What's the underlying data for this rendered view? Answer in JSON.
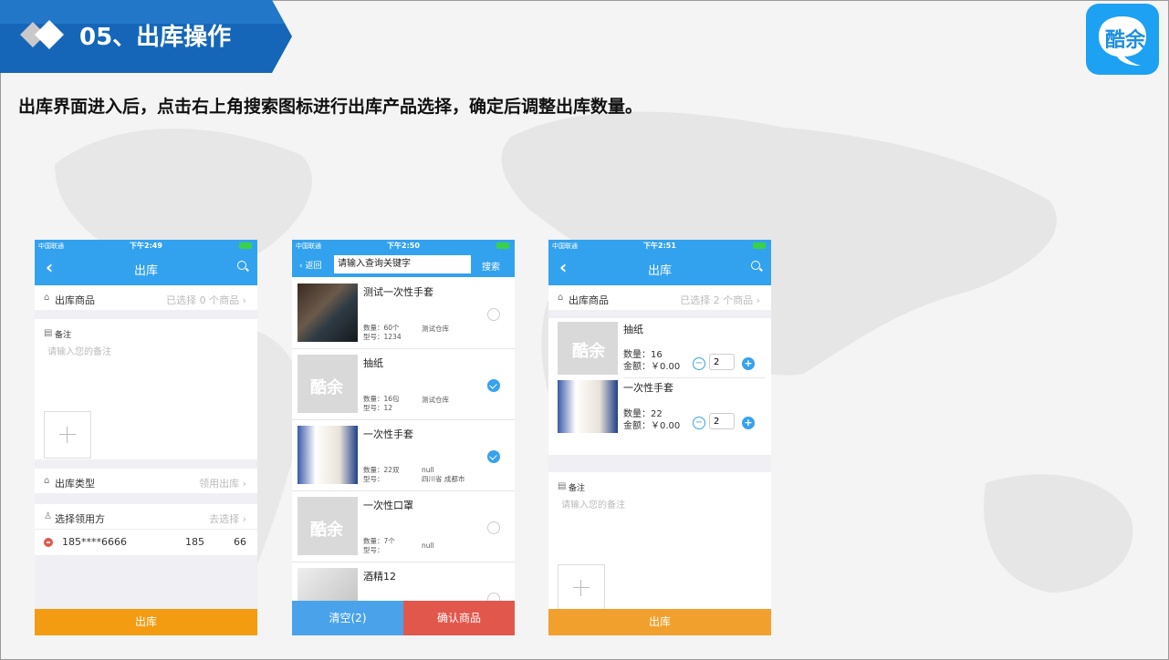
{
  "header": {
    "title": "05、出库操作",
    "subtitle": "出库界面进入后，点击右上角搜索图标进行出库产品选择，确定后调整出库数量。",
    "logo_text": "酷余"
  },
  "status": {
    "carrier": "中国联通"
  },
  "phone1": {
    "time": "下午2:49",
    "nav_title": "出库",
    "goods_label": "出库商品",
    "goods_value": "已选择 0 个商品",
    "remark_label": "备注",
    "remark_placeholder": "请输入您的备注",
    "type_label": "出库类型",
    "type_value": "领用出库",
    "receiver_label": "选择领用方",
    "receiver_value": "去选择",
    "receiver_phone": "185****6666",
    "receiver_mid": "185",
    "receiver_end": "66",
    "submit": "出库"
  },
  "phone2": {
    "time": "下午2:50",
    "back": "返回",
    "search_placeholder": "请输入查询关键字",
    "search_btn": "搜索",
    "items": [
      {
        "name": "测试一次性手套",
        "qty": "数量：60个",
        "model": "型号：1234",
        "loc": "测试仓库",
        "loc2": "",
        "checked": false
      },
      {
        "name": "抽纸",
        "qty": "数量：16包",
        "model": "型号：12",
        "loc": "测试仓库",
        "loc2": "",
        "checked": true
      },
      {
        "name": "一次性手套",
        "qty": "数量：22双",
        "model": "型号：",
        "loc": "null",
        "loc2": "四川省 成都市",
        "checked": true
      },
      {
        "name": "一次性口罩",
        "qty": "数量：7个",
        "model": "型号：",
        "loc": "null",
        "loc2": "",
        "checked": false
      },
      {
        "name": "酒精12",
        "qty": "",
        "model": "",
        "loc": "",
        "loc2": "",
        "checked": false
      }
    ],
    "clear_btn": "清空(2)",
    "confirm_btn": "确认商品"
  },
  "phone3": {
    "time": "下午2:51",
    "nav_title": "出库",
    "goods_label": "出库商品",
    "goods_value": "已选择 2 个商品",
    "items": [
      {
        "name": "抽纸",
        "qty": "数量：16",
        "amount": "金额：￥0.00",
        "count": "2"
      },
      {
        "name": "一次性手套",
        "qty": "数量：22",
        "amount": "金额：￥0.00",
        "count": "2"
      }
    ],
    "remark_label": "备注",
    "remark_placeholder": "请输入您的备注",
    "submit": "出库"
  },
  "colors": {
    "accent": "#33a2ee",
    "orange": "#f2a02d",
    "red": "#e2574c",
    "blue_btn": "#4aa3ea"
  }
}
